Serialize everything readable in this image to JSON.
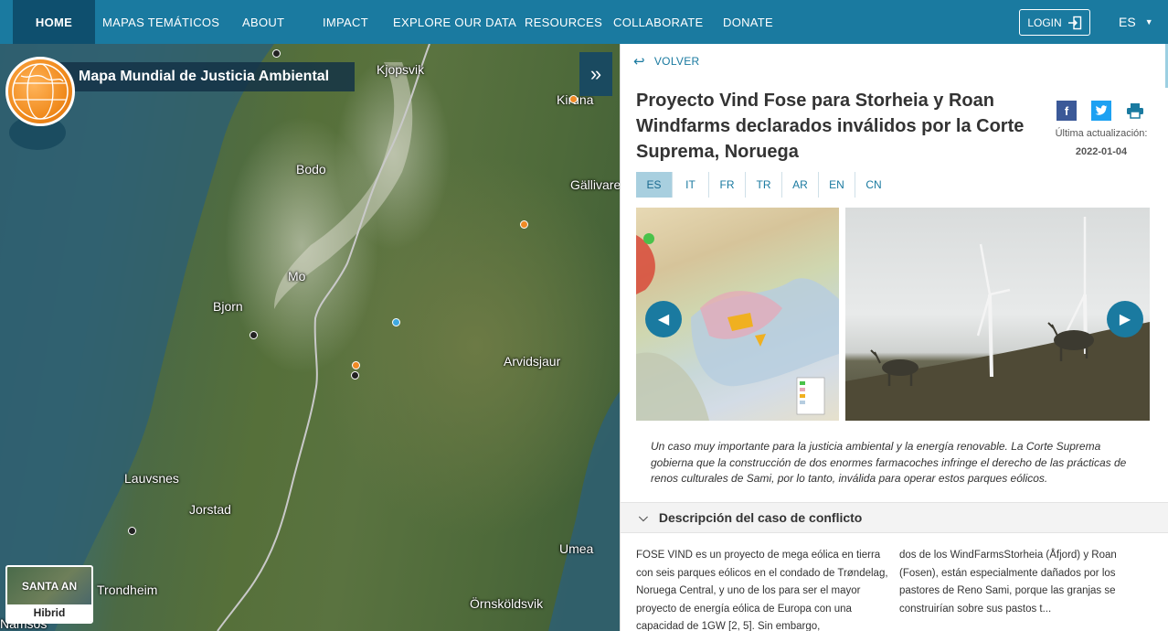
{
  "navbar": {
    "items": [
      {
        "label": "HOME",
        "active": true
      },
      {
        "label": "MAPAS TEMÁTICOS"
      },
      {
        "label": "ABOUT"
      },
      {
        "label": "IMPACT"
      },
      {
        "label": "EXPLORE OUR DATA"
      },
      {
        "label": "RESOURCES"
      },
      {
        "label": "COLLABORATE"
      },
      {
        "label": "DONATE"
      }
    ],
    "login_label": "LOGIN",
    "language": "ES"
  },
  "map": {
    "title": "Mapa Mundial de Justicia Ambiental",
    "places": [
      "Kjopsvik",
      "Kiruna",
      "Bodo",
      "Gällivare",
      "Mo",
      "Bjorn",
      "Arvidsjaur",
      "Lauvsnes",
      "Jorstad",
      "Umea",
      "Trondheim",
      "Örnsköldsvik",
      "Namsos"
    ],
    "layer_switch": {
      "name": "SANTA AN",
      "label": "Hibrid"
    }
  },
  "panel": {
    "back_label": "VOLVER",
    "title": "Proyecto Vind Fose para Storheia y Roan Windfarms declarados inválidos por la Corte Suprema, Noruega",
    "share": {
      "facebook": "f",
      "twitter": "t"
    },
    "update_label": "Última actualización:",
    "update_date": "2022-01-04",
    "languages": [
      "ES",
      "IT",
      "FR",
      "TR",
      "AR",
      "EN",
      "CN"
    ],
    "active_language": "ES",
    "summary": "Un caso muy importante para la justicia ambiental y la energía renovable. La Corte Suprema gobierna que la construcción de dos enormes farmacoches infringe el derecho de las prácticas de renos culturales de Sami, por lo tanto, inválida para operar estos parques eólicos.",
    "description_header": "Descripción del caso de conflicto",
    "description_col1": "FOSE VIND es un proyecto de mega eólica en tierra con seis parques eólicos en el condado de Trøndelag, Noruega Central, y uno de los para ser el mayor proyecto de energía eólica de Europa con una capacidad de 1GW [2, 5]. Sin embargo,",
    "description_col2": "dos de los WindFarmsStorheia (Åfjord) y Roan (Fosen), están especialmente dañados por los pastores de Reno Sami, porque las granjas se construirían sobre sus pastos t..."
  },
  "colors": {
    "navbar": "#1a7aa0",
    "home_active": "#0e4f6e",
    "accent": "#1a7aa0",
    "marker_orange": "#ef8a25",
    "marker_blue": "#3fa9e0"
  }
}
